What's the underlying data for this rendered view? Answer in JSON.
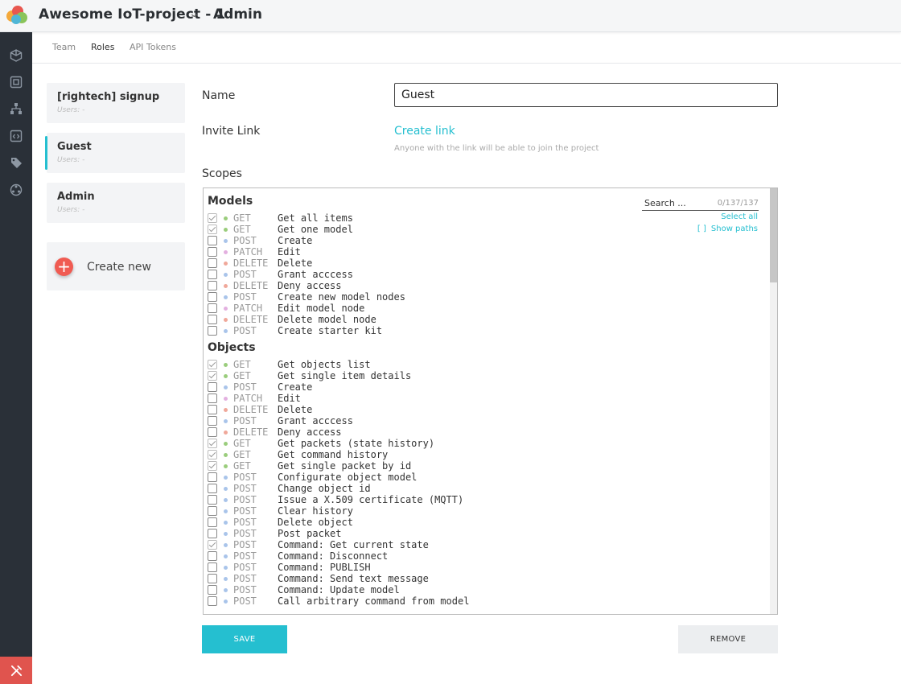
{
  "header": {
    "project_title": "Awesome IoT-project - 1",
    "page_title": "Admin"
  },
  "tabs": [
    {
      "label": "Team"
    },
    {
      "label": "Roles"
    },
    {
      "label": "API Tokens"
    }
  ],
  "roles": [
    {
      "name": "[rightech] signup",
      "users": "Users: -"
    },
    {
      "name": "Guest",
      "users": "Users: -"
    },
    {
      "name": "Admin",
      "users": "Users: -"
    }
  ],
  "create_new_label": "Create new",
  "form": {
    "name_label": "Name",
    "name_value": "Guest",
    "invite_label": "Invite Link",
    "create_link": "Create link",
    "invite_hint": "Anyone with the link will be able to join the project",
    "scopes_label": "Scopes"
  },
  "scopes_panel": {
    "search_placeholder": "Search ...",
    "count": "0/137/137",
    "select_all": "Select all",
    "show_paths_bracket": "[  ]",
    "show_paths": "Show paths"
  },
  "method_colors": {
    "GET": "#9acd7c",
    "POST": "#a9c4ea",
    "PATCH": "#e3b0e0",
    "DELETE": "#f0a89a"
  },
  "groups": [
    {
      "title": "Models",
      "items": [
        {
          "method": "GET",
          "label": "Get all items",
          "checked": true
        },
        {
          "method": "GET",
          "label": "Get one model",
          "checked": true
        },
        {
          "method": "POST",
          "label": "Create",
          "checked": false
        },
        {
          "method": "PATCH",
          "label": "Edit",
          "checked": false
        },
        {
          "method": "DELETE",
          "label": "Delete",
          "checked": false
        },
        {
          "method": "POST",
          "label": "Grant acccess",
          "checked": false
        },
        {
          "method": "DELETE",
          "label": "Deny access",
          "checked": false
        },
        {
          "method": "POST",
          "label": "Create new model nodes",
          "checked": false
        },
        {
          "method": "PATCH",
          "label": "Edit model node",
          "checked": false
        },
        {
          "method": "DELETE",
          "label": "Delete model node",
          "checked": false
        },
        {
          "method": "POST",
          "label": "Create starter kit",
          "checked": false
        }
      ]
    },
    {
      "title": "Objects",
      "items": [
        {
          "method": "GET",
          "label": "Get objects list",
          "checked": true
        },
        {
          "method": "GET",
          "label": "Get single item details",
          "checked": true
        },
        {
          "method": "POST",
          "label": "Create",
          "checked": false
        },
        {
          "method": "PATCH",
          "label": "Edit",
          "checked": false
        },
        {
          "method": "DELETE",
          "label": "Delete",
          "checked": false
        },
        {
          "method": "POST",
          "label": "Grant acccess",
          "checked": false
        },
        {
          "method": "DELETE",
          "label": "Deny access",
          "checked": false
        },
        {
          "method": "GET",
          "label": "Get packets (state history)",
          "checked": true
        },
        {
          "method": "GET",
          "label": "Get command history",
          "checked": true
        },
        {
          "method": "GET",
          "label": "Get single packet by id",
          "checked": true
        },
        {
          "method": "POST",
          "label": "Configurate object model",
          "checked": false
        },
        {
          "method": "POST",
          "label": "Change object id",
          "checked": false
        },
        {
          "method": "POST",
          "label": "Issue a X.509 certificate (MQTT)",
          "checked": false
        },
        {
          "method": "POST",
          "label": "Clear history",
          "checked": false
        },
        {
          "method": "POST",
          "label": "Delete object",
          "checked": false
        },
        {
          "method": "POST",
          "label": "Post packet",
          "checked": false
        },
        {
          "method": "POST",
          "label": "Command: Get current state",
          "checked": true
        },
        {
          "method": "POST",
          "label": "Command: Disconnect",
          "checked": false
        },
        {
          "method": "POST",
          "label": "Command: PUBLISH",
          "checked": false
        },
        {
          "method": "POST",
          "label": "Command: Send text message",
          "checked": false
        },
        {
          "method": "POST",
          "label": "Command: Update model",
          "checked": false
        },
        {
          "method": "POST",
          "label": "Call arbitrary command from model",
          "checked": false
        }
      ]
    }
  ],
  "buttons": {
    "save": "SAVE",
    "remove": "REMOVE"
  }
}
